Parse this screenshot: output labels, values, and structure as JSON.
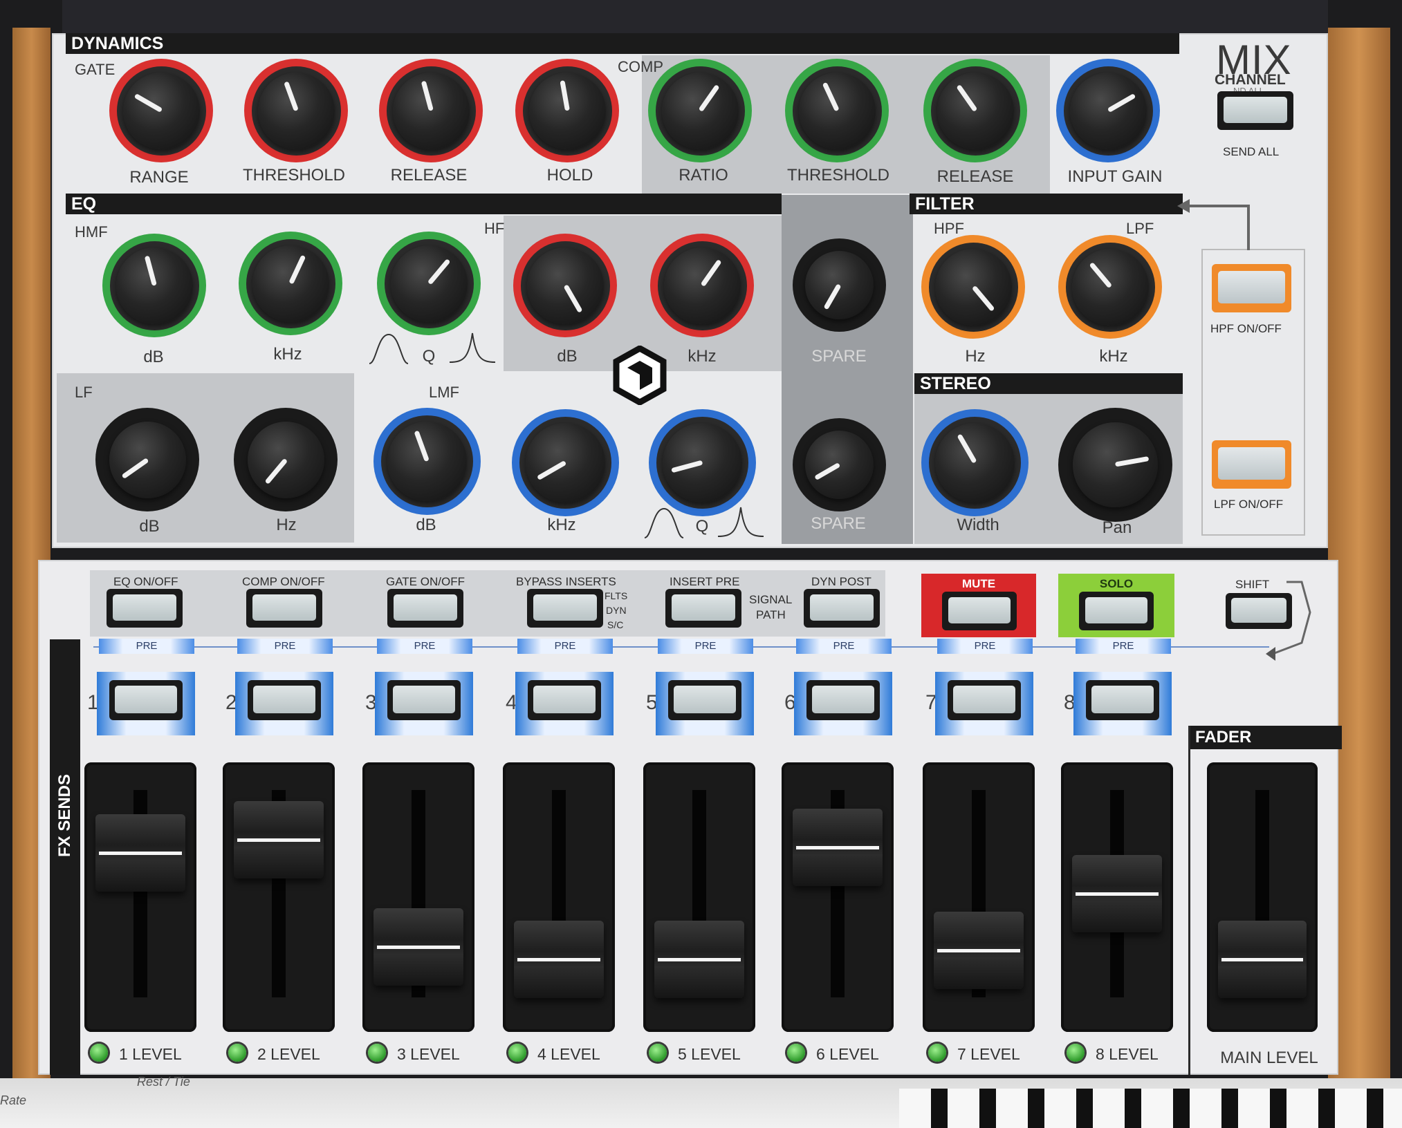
{
  "brand": {
    "logo": "MIX",
    "sublogo": "CHANNEL",
    "logo_icon": "cube-logo-icon"
  },
  "colors": {
    "red": "#d9302f",
    "green": "#36a646",
    "blue": "#2d6fd0",
    "orange": "#f08a2a",
    "mute": "#d8282a",
    "solo": "#8ccf3a"
  },
  "sections": {
    "dynamics": "DYNAMICS",
    "gate": "GATE",
    "comp": "COMP",
    "eq": "EQ",
    "hmf": "HMF",
    "hf": "HF",
    "lf": "LF",
    "lmf": "LMF",
    "filter": "FILTER",
    "hpf": "HPF",
    "lpf": "LPF",
    "stereo": "STEREO",
    "fader": "FADER",
    "fx_sends": "FX SENDS"
  },
  "knobs": {
    "gate_range": "RANGE",
    "gate_threshold": "THRESHOLD",
    "gate_release": "RELEASE",
    "gate_hold": "HOLD",
    "comp_ratio": "RATIO",
    "comp_threshold": "THRESHOLD",
    "comp_release": "RELEASE",
    "input_gain": "INPUT GAIN",
    "hmf_db": "dB",
    "hmf_khz": "kHz",
    "hmf_q": "Q",
    "hf_db": "dB",
    "hf_khz": "kHz",
    "spare_1": "SPARE",
    "hpf_hz": "Hz",
    "lpf_khz": "kHz",
    "lf_db": "dB",
    "lf_hz": "Hz",
    "lmf_db": "dB",
    "lmf_khz": "kHz",
    "lmf_q": "Q",
    "spare_2": "SPARE",
    "width": "Width",
    "pan": "Pan"
  },
  "buttons": {
    "send_all_top": "ND ALL",
    "send_all": "SEND ALL",
    "hpf_onoff": "HPF ON/OFF",
    "lpf_onoff": "LPF ON/OFF",
    "eq_onoff": "EQ ON/OFF",
    "comp_onoff": "COMP ON/OFF",
    "gate_onoff": "GATE ON/OFF",
    "bypass_inserts": "BYPASS INSERTS",
    "flts": "FLTS",
    "dyn": "DYN",
    "sc": "S/C",
    "insert_pre": "INSERT PRE",
    "signal": "SIGNAL",
    "path": "PATH",
    "dyn_post": "DYN POST",
    "mute": "MUTE",
    "solo": "SOLO",
    "shift": "SHIFT"
  },
  "pre_label": "PRE",
  "channels": [
    {
      "num": "1",
      "level": "1 LEVEL",
      "fader_value": 0.75
    },
    {
      "num": "2",
      "level": "2 LEVEL",
      "fader_value": 0.82
    },
    {
      "num": "3",
      "level": "3 LEVEL",
      "fader_value": 0.22
    },
    {
      "num": "4",
      "level": "4 LEVEL",
      "fader_value": 0.15
    },
    {
      "num": "5",
      "level": "5 LEVEL",
      "fader_value": 0.15
    },
    {
      "num": "6",
      "level": "6 LEVEL",
      "fader_value": 0.78
    },
    {
      "num": "7",
      "level": "7 LEVEL",
      "fader_value": 0.2
    },
    {
      "num": "8",
      "level": "8 LEVEL",
      "fader_value": 0.52
    }
  ],
  "main_level": {
    "label": "MAIN LEVEL",
    "fader_value": 0.15
  },
  "background_labels": {
    "rate": "Rate",
    "rest_tie": "Rest / Tie"
  },
  "knob_angles_deg": {
    "gate_range": -60,
    "gate_threshold": -20,
    "gate_release": -15,
    "gate_hold": -10,
    "comp_ratio": 35,
    "comp_threshold": -25,
    "comp_release": -35,
    "input_gain": 60,
    "hmf_db": -15,
    "hmf_khz": 25,
    "hmf_q": 40,
    "hf_db": 150,
    "hf_khz": 35,
    "spare_1": 210,
    "hpf_hz": 140,
    "lpf_khz": -40,
    "lf_db": 235,
    "lf_hz": 220,
    "lmf_db": -20,
    "lmf_khz": 240,
    "lmf_q": 255,
    "spare_2": 240,
    "width": -30,
    "pan": 80
  }
}
